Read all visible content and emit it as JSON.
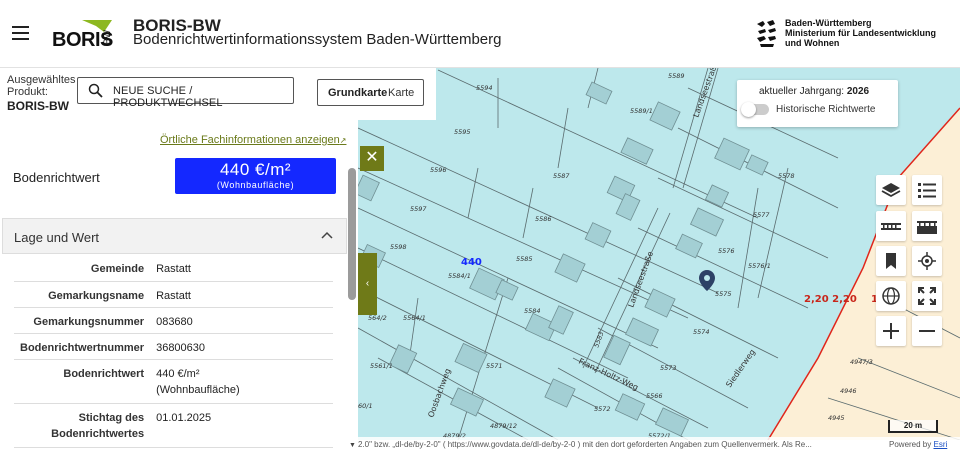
{
  "header": {
    "logo_text": "BORIS",
    "logo_suffix": "BW",
    "title": "BORIS-BW",
    "subtitle": "Bodenrichtwertinformationssystem  Baden-Württemberg",
    "ministry_line1": "Baden-Württemberg",
    "ministry_line2": "Ministerium für Landesentwicklung",
    "ministry_line3": "und Wohnen"
  },
  "sidebar": {
    "product_label": "Ausgewähltes Produkt:",
    "product_name": "BORIS-BW",
    "search_label": "NEUE SUCHE / PRODUKTWECHSEL",
    "basemap_label": "Grundkarte",
    "basemap_value": "Karte",
    "fachinfo_link": "Örtliche Fachinformationen anzeigen",
    "brw_label": "Bodenrichtwert",
    "brw_value": "440 €/m²",
    "brw_note": "(Wohnbaufläche)",
    "section_title": "Lage und Wert",
    "details": [
      {
        "key": "Gemeinde",
        "value": "Rastatt"
      },
      {
        "key": "Gemarkungsname",
        "value": "Rastatt"
      },
      {
        "key": "Gemarkungsnummer",
        "value": "083680"
      },
      {
        "key": "Bodenrichtwertnummer",
        "value": "36800630"
      },
      {
        "key": "Bodenrichtwert",
        "value": "440 €/m²",
        "value2": "(Wohnbaufläche)"
      },
      {
        "key": "Stichtag des",
        "key2": "Bodenrichtwertes",
        "value": "01.01.2025"
      }
    ]
  },
  "map": {
    "year_prefix": "aktueller Jahrgang:",
    "year_value": "2026",
    "historic_label": "Historische Richtwerte",
    "historic_enabled": false,
    "zone_label": "440",
    "zone_neighbor_label": "2,20 2,20",
    "zone_neighbor_extra": "1",
    "street_labels": [
      "Landseestraße",
      "Landseestraße",
      "Franz-Holtz-Weg",
      "Oosbachweg",
      "Siedlerweg"
    ],
    "parcel_labels": [
      "5589",
      "5594",
      "5589/1",
      "5595",
      "5596",
      "5587",
      "5597",
      "5586",
      "5578",
      "5577",
      "5598",
      "5585",
      "5584/1",
      "5576",
      "5576/1",
      "5575",
      "5584",
      "5574",
      "5564/1",
      "5561/1",
      "5571",
      "5573",
      "5572",
      "5566",
      "4879/12",
      "4879/2",
      "4947/3",
      "4946",
      "4945",
      "5583",
      "5572/1",
      "564/2",
      "60/1",
      "/84/2"
    ],
    "attribution": "2.0\" bzw. „dl-de/by-2-0\" ( https://www.govdata.de/dl-de/by-2-0 ) mit den dort geforderten Angaben zum Quellenvermerk. Als Re...",
    "powered_by": "Powered by",
    "powered_link": "Esri",
    "scale": "20 m",
    "colors": {
      "zone_fill": "#bde8ec",
      "neighbor_fill": "#fcefd6",
      "border_red": "#e0261b",
      "accent_green": "#6f7a18",
      "value_blue": "#1428ff"
    }
  },
  "icons": [
    "menu-icon",
    "search-icon",
    "external-link-icon",
    "chevron-up-icon",
    "close-icon",
    "chevron-left-icon",
    "layers-icon",
    "list-icon",
    "measure-distance-icon",
    "measure-area-icon",
    "bookmark-icon",
    "locate-icon",
    "globe-icon",
    "fullscreen-icon",
    "zoom-in-icon",
    "zoom-out-icon",
    "map-pin-icon"
  ]
}
